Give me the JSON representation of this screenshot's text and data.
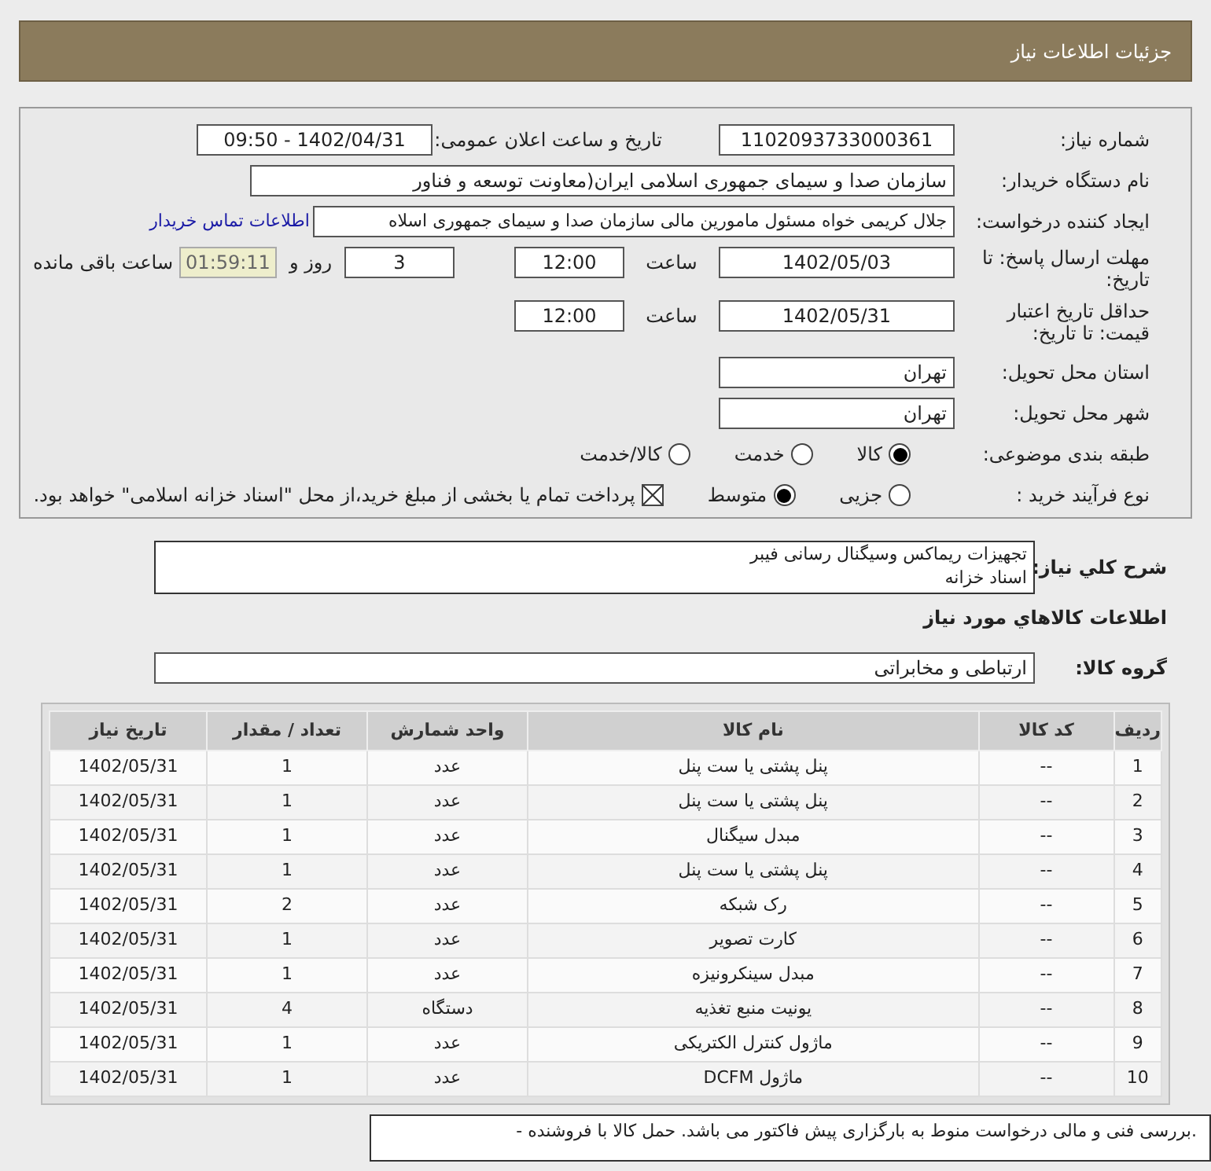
{
  "header": {
    "title": "جزئیات اطلاعات نیاز"
  },
  "details": {
    "need_number": {
      "label": "شماره نیاز:",
      "value": "1102093733000361"
    },
    "announce": {
      "label": "تاریخ و ساعت اعلان عمومی:",
      "value": "1402/04/31 - 09:50"
    },
    "buyer": {
      "label": "نام دستگاه خریدار:",
      "value": "سازمان صدا و سیمای جمهوری اسلامی ایران(معاونت توسعه و فناور"
    },
    "requester": {
      "label": "ایجاد کننده درخواست:",
      "value": "جلال کریمی خواه مسئول مامورین مالی  سازمان صدا و سیمای جمهوری اسلاه",
      "link": "اطلاعات تماس خریدار"
    },
    "deadline": {
      "label": "مهلت ارسال پاسخ: تا تاریخ:",
      "date": "1402/05/03",
      "time_label": "ساعت",
      "time": "12:00",
      "days": "3",
      "days_label": "روز و",
      "remaining": "01:59:11",
      "remaining_label": "ساعت باقی مانده"
    },
    "validity": {
      "label": "حداقل تاریخ اعتبار قیمت: تا تاریخ:",
      "date": "1402/05/31",
      "time_label": "ساعت",
      "time": "12:00"
    },
    "province": {
      "label": "استان محل تحویل:",
      "value": "تهران"
    },
    "city": {
      "label": "شهر محل تحویل:",
      "value": "تهران"
    },
    "category": {
      "label": "طبقه بندی موضوعی:",
      "options": [
        {
          "label": "کالا",
          "selected": true
        },
        {
          "label": "خدمت",
          "selected": false
        },
        {
          "label": "کالا/خدمت",
          "selected": false
        }
      ]
    },
    "process": {
      "label": "نوع فرآیند خرید :",
      "options": [
        {
          "label": "جزیی",
          "selected": false
        },
        {
          "label": "متوسط",
          "selected": true
        }
      ],
      "treasury": {
        "checked": true,
        "text": "پرداخت تمام یا بخشی از مبلغ خرید،از محل \"اسناد خزانه اسلامی\" خواهد بود."
      }
    }
  },
  "summary": {
    "label": "شرح کلي نیاز:",
    "lines": [
      "تجهیزات ریماکس وسیگنال رسانی فیبر",
      "اسناد خزانه"
    ]
  },
  "goods_title": "اطلاعات کالاهاي مورد نیاز",
  "goods_group": {
    "label": "گروه کالا:",
    "value": "ارتباطی و مخابراتی"
  },
  "table": {
    "columns": [
      "ردیف",
      "کد کالا",
      "نام کالا",
      "واحد شمارش",
      "تعداد / مقدار",
      "تاریخ نیاز"
    ],
    "rows": [
      [
        "1",
        "--",
        "پنل پشتی یا ست پنل",
        "عدد",
        "1",
        "1402/05/31"
      ],
      [
        "2",
        "--",
        "پنل پشتی یا ست پنل",
        "عدد",
        "1",
        "1402/05/31"
      ],
      [
        "3",
        "--",
        "مبدل سیگنال",
        "عدد",
        "1",
        "1402/05/31"
      ],
      [
        "4",
        "--",
        "پنل پشتی یا ست پنل",
        "عدد",
        "1",
        "1402/05/31"
      ],
      [
        "5",
        "--",
        "رک شبکه",
        "عدد",
        "2",
        "1402/05/31"
      ],
      [
        "6",
        "--",
        "کارت تصویر",
        "عدد",
        "1",
        "1402/05/31"
      ],
      [
        "7",
        "--",
        "مبدل سینکرونیزه",
        "عدد",
        "1",
        "1402/05/31"
      ],
      [
        "8",
        "--",
        "یونیت منبع تغذیه",
        "دستگاه",
        "4",
        "1402/05/31"
      ],
      [
        "9",
        "--",
        "ماژول کنترل الکتریکی",
        "عدد",
        "1",
        "1402/05/31"
      ],
      [
        "10",
        "--",
        "ماژول DCFM",
        "عدد",
        "1",
        "1402/05/31"
      ]
    ]
  },
  "note": ".بررسی فنی و مالی درخواست منوط به بارگزاری پیش فاکتور می باشد. حمل کالا با فروشنده -"
}
